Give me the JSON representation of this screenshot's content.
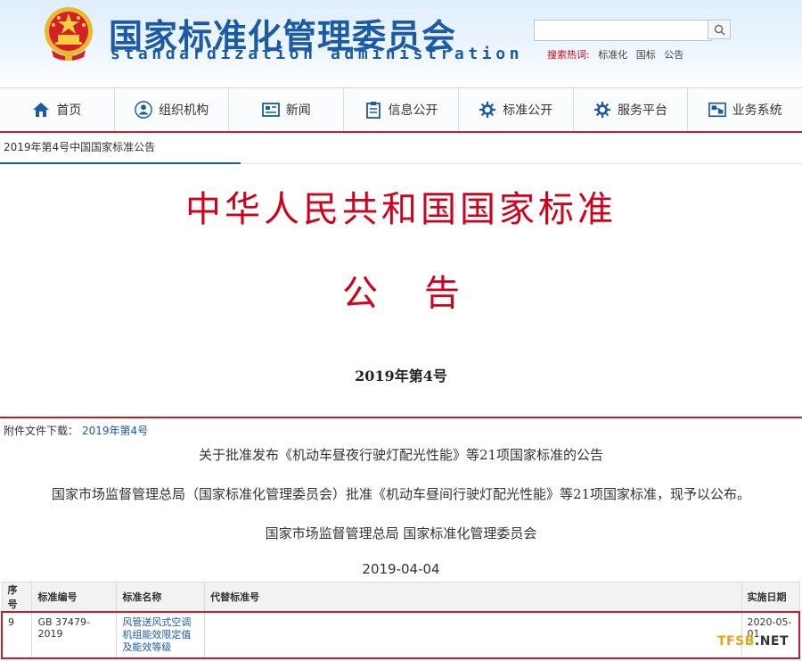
{
  "header": {
    "title": "国家标准化管理委员会",
    "subtitle": "standardization administration",
    "search": {
      "placeholder": ""
    },
    "hot_search": {
      "label": "搜索热词:",
      "keywords": [
        "标准化",
        "国标",
        "公告"
      ]
    }
  },
  "nav": [
    {
      "label": "首页",
      "icon": "home-icon"
    },
    {
      "label": "组织机构",
      "icon": "person-icon"
    },
    {
      "label": "新闻",
      "icon": "news-icon"
    },
    {
      "label": "信息公开",
      "icon": "clipboard-icon"
    },
    {
      "label": "标准公开",
      "icon": "gear-icon"
    },
    {
      "label": "服务平台",
      "icon": "gear-icon"
    },
    {
      "label": "业务系统",
      "icon": "system-icon"
    }
  ],
  "breadcrumb": "2019年第4号中国国家标准公告",
  "notice": {
    "title": "中华人民共和国国家标准",
    "subtitle": "公告",
    "number": "2019年第4号",
    "attachment_label": "附件文件下载：",
    "attachment_link": "2019年第4号",
    "heading": "关于批准发布《机动车昼夜行驶灯配光性能》等21项国家标准的公告",
    "body": "国家市场监督管理总局（国家标准化管理委员会）批准《机动车昼间行驶灯配光性能》等21项国家标准，现予以公布。",
    "issuer": "国家市场监督管理总局 国家标准化管理委员会",
    "date": "2019-04-04"
  },
  "table": {
    "headers": [
      "序号",
      "标准编号",
      "标准名称",
      "代替标准号",
      "实施日期"
    ],
    "rows": [
      {
        "no": "9",
        "code": "GB 37479-2019",
        "name": "风管送风式空调机组能效限定值及能效等级",
        "replace": "",
        "date": "2020-05-01"
      }
    ]
  },
  "watermark": {
    "part1": "TFSB",
    "part2": ".NET"
  },
  "colors": {
    "brand_blue": "#1a5aa6",
    "notice_red": "#d0021b",
    "highlight_red": "#c81e2b"
  }
}
